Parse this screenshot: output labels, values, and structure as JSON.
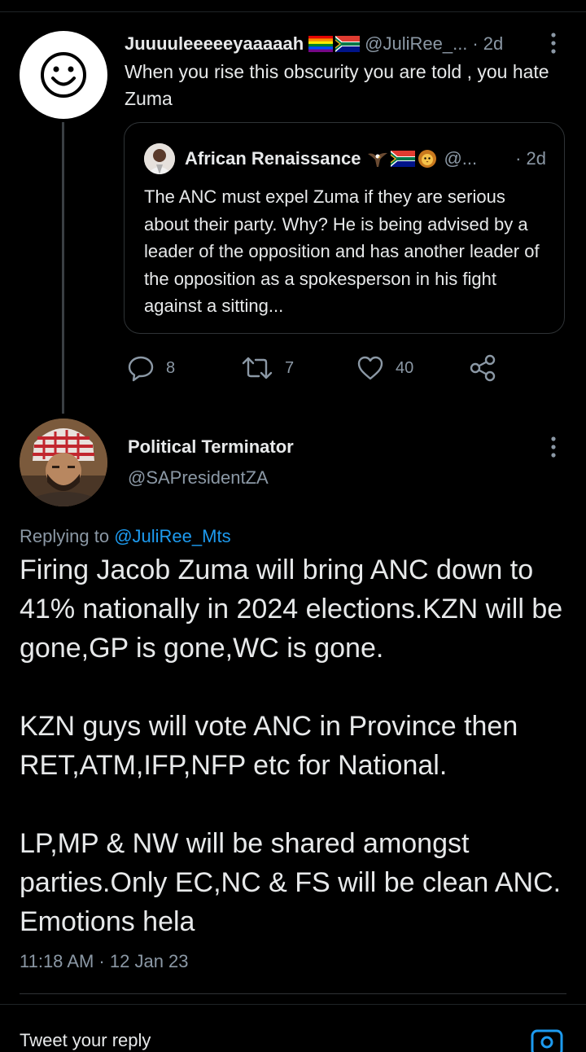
{
  "parent_tweet": {
    "name": "Juuuuleeeeeyaaaaah",
    "handle": "@JuliRee_...",
    "dot": "·",
    "time": "2d",
    "text": "When you rise this obscurity you are told , you hate Zuma",
    "flag_icons": [
      "rainbow-flag-icon",
      "south-africa-flag-icon"
    ]
  },
  "quote": {
    "name": "African Renaissance",
    "handle": "@...",
    "time": "· 2d",
    "text": "The ANC must expel Zuma if they are serious about their party. Why? He is being advised by a leader of the opposition and has another leader of the opposition as a spokesperson in his fight against a sitting...",
    "emoji_icons": [
      "eagle-icon",
      "south-africa-flag-icon",
      "lion-icon"
    ]
  },
  "actions": {
    "replies": "8",
    "retweets": "7",
    "likes": "40"
  },
  "main_tweet": {
    "name": "Political Terminator",
    "handle": "@SAPresidentZA",
    "replying_prefix": "Replying to ",
    "replying_to": "@JuliRee_Mts",
    "text": "Firing Jacob Zuma will bring ANC down to 41% nationally in 2024 elections.KZN will be gone,GP is gone,WC is gone.\n\nKZN guys will vote ANC in Province then RET,ATM,IFP,NFP etc for National.\n\nLP,MP & NW will be shared amongst parties.Only EC,NC & FS will be clean ANC. Emotions hela",
    "timestamp": "11:18 AM · 12 Jan 23"
  },
  "bottom": {
    "partial_text": "Tweet your reply"
  },
  "colors": {
    "background": "#000000",
    "text": "#e7e9ea",
    "muted": "#8b98a5",
    "link": "#1d9bf0"
  }
}
